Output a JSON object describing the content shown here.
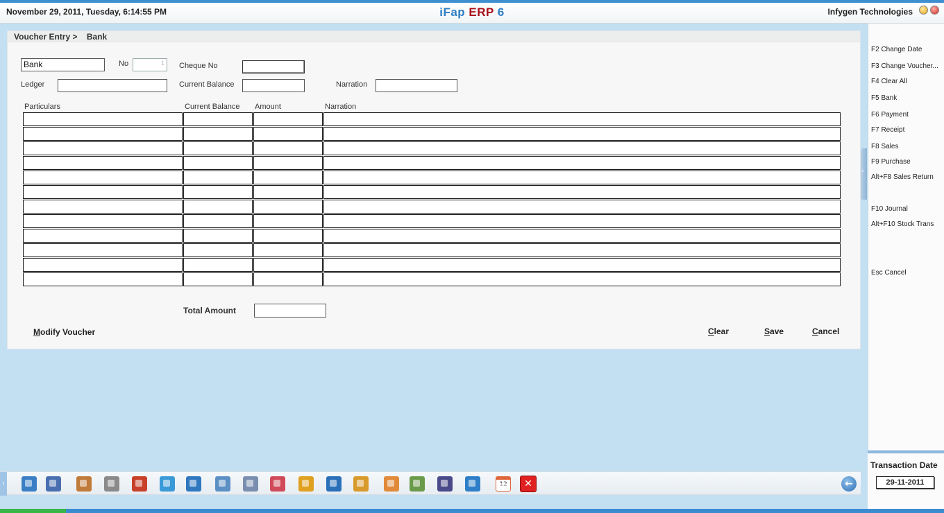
{
  "header": {
    "datetime": "November  29, 2011, Tuesday, 6:14:55 PM",
    "title_part1": "iFap",
    "title_part2": "ERP",
    "title_part3": "6",
    "company": "Infygen Technologies"
  },
  "breadcrumb": {
    "section": "Voucher Entry >",
    "page": "Bank"
  },
  "form": {
    "voucher_type_value": "Bank",
    "no_label": "No",
    "no_value": "1",
    "cheque_no_label": "Cheque No",
    "cheque_no_value": "",
    "ledger_label": "Ledger",
    "ledger_value": "",
    "current_balance_label": "Current Balance",
    "current_balance_value": "",
    "narration_label": "Narration",
    "narration_value": ""
  },
  "grid": {
    "columns": [
      "Particulars",
      "Current Balance",
      "Amount",
      "Narration"
    ],
    "rows": [
      [
        "",
        "",
        "",
        ""
      ],
      [
        "",
        "",
        "",
        ""
      ],
      [
        "",
        "",
        "",
        ""
      ],
      [
        "",
        "",
        "",
        ""
      ],
      [
        "",
        "",
        "",
        ""
      ],
      [
        "",
        "",
        "",
        ""
      ],
      [
        "",
        "",
        "",
        ""
      ],
      [
        "",
        "",
        "",
        ""
      ],
      [
        "",
        "",
        "",
        ""
      ],
      [
        "",
        "",
        "",
        ""
      ],
      [
        "",
        "",
        "",
        ""
      ],
      [
        "",
        "",
        "",
        ""
      ]
    ]
  },
  "totals": {
    "label": "Total Amount",
    "value": ""
  },
  "actions": {
    "modify_hotkey": "M",
    "modify_rest": "odify Voucher",
    "clear_hotkey": "C",
    "clear_rest": "lear",
    "save_hotkey": "S",
    "save_rest": "ave",
    "cancel_hotkey": "C",
    "cancel_rest": "ancel"
  },
  "shortcuts": [
    "F2 Change Date",
    "F3 Change Voucher...",
    "F4 Clear All",
    "F5 Bank",
    "F6 Payment",
    "F7 Receipt",
    "F8 Sales",
    "F9 Purchase",
    "Alt+F8 Sales Return",
    "F10 Journal",
    "Alt+F10 Stock Trans",
    "Esc Cancel"
  ],
  "transaction": {
    "label": "Transaction Date",
    "date": "29-11-2011"
  },
  "toolbar": {
    "icons": [
      {
        "name": "masters-icon",
        "color": "#3a7fc4"
      },
      {
        "name": "user-icon",
        "color": "#4a6fb0"
      },
      {
        "name": "accounts-icon",
        "color": "#c07a3a"
      },
      {
        "name": "settings-icon",
        "color": "#8a8a8a"
      },
      {
        "name": "books-icon",
        "color": "#c8402a"
      },
      {
        "name": "cart-icon",
        "color": "#3a9ad8"
      },
      {
        "name": "refresh-icon",
        "color": "#2f78c0"
      },
      {
        "name": "window-icon",
        "color": "#5c8fc4"
      },
      {
        "name": "document-icon",
        "color": "#7a8fb0"
      },
      {
        "name": "chart-icon",
        "color": "#d04a5a"
      },
      {
        "name": "tree-icon",
        "color": "#e0a020"
      },
      {
        "name": "network-icon",
        "color": "#2a6fb8"
      },
      {
        "name": "box-icon",
        "color": "#d89a2a"
      },
      {
        "name": "cycle-icon",
        "color": "#e08a3a"
      },
      {
        "name": "spreadsheet-icon",
        "color": "#6a9a4a"
      },
      {
        "name": "save-disk-icon",
        "color": "#4a4a8a"
      },
      {
        "name": "gear-icon",
        "color": "#2f7fc8"
      },
      {
        "name": "calendar-icon",
        "color": "#e0643a"
      }
    ],
    "calendar_day": "12",
    "close_glyph": "✕",
    "back_glyph": "←"
  }
}
